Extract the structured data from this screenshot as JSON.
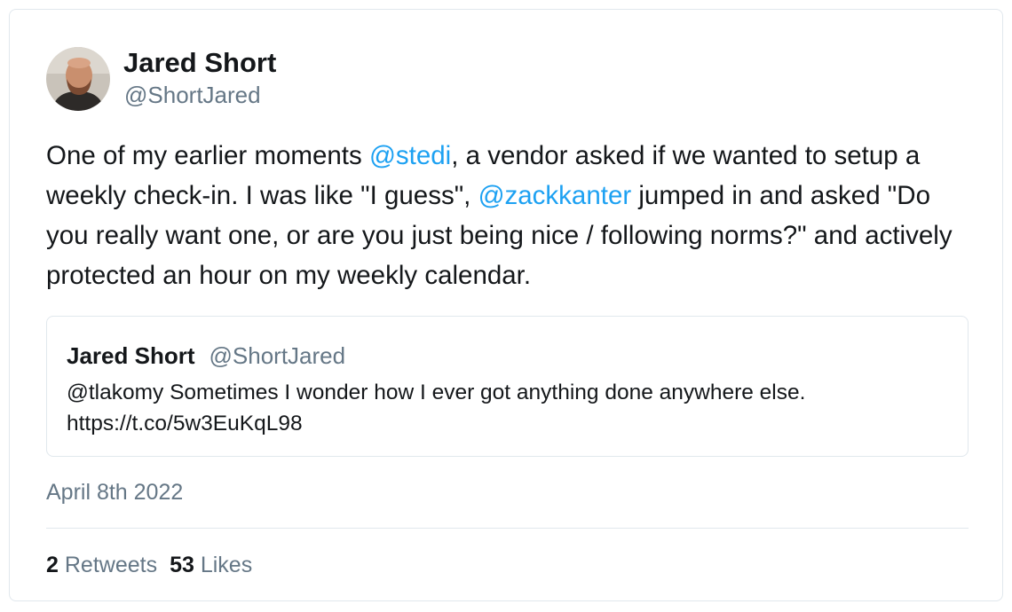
{
  "tweet": {
    "author": {
      "name": "Jared Short",
      "handle": "@ShortJared"
    },
    "text_parts": [
      "One of my earlier moments ",
      "@stedi",
      ", a vendor asked if we wanted to setup a weekly check-in. I was like \"I guess\", ",
      "@zackkanter",
      " jumped in and asked \"Do you really want one, or are you just being nice / following norms?\" and actively protected an hour on my weekly calendar."
    ],
    "quoted_tweet": {
      "author_name": "Jared Short",
      "author_handle": "@ShortJared",
      "text_line1": "@tlakomy Sometimes I wonder how I ever got anything done anywhere else.",
      "text_line2": "https://t.co/5w3EuKqL98"
    },
    "date": "April 8th 2022",
    "stats": {
      "retweets_count": "2",
      "retweets_label": "Retweets",
      "likes_count": "53",
      "likes_label": "Likes"
    },
    "colors": {
      "mention": "#1da1f2",
      "secondary_text": "#657786",
      "border": "#e1e8ed"
    }
  }
}
